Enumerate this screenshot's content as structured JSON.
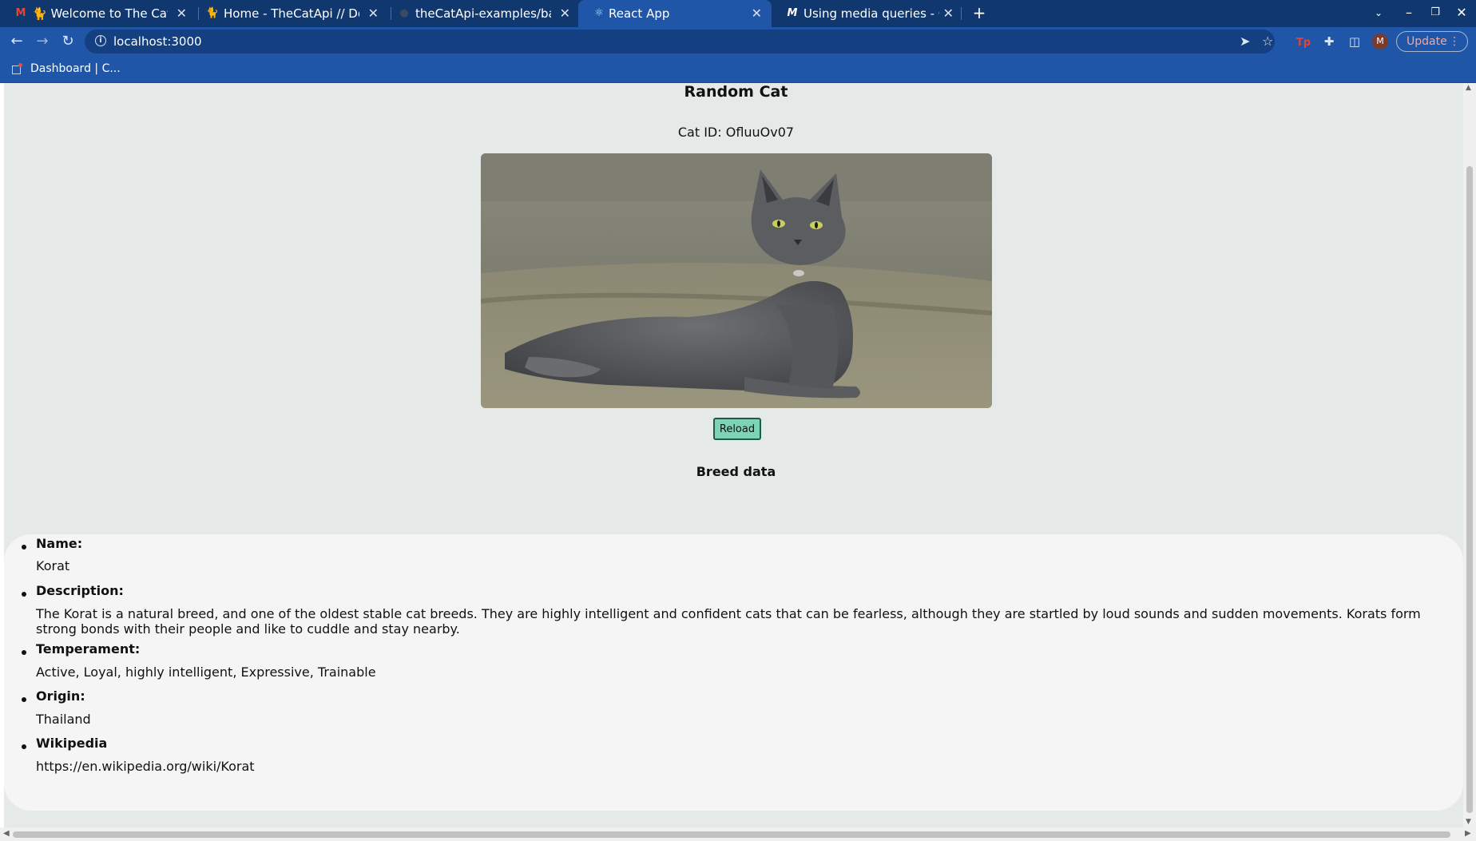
{
  "browser": {
    "tabs": [
      {
        "title": "🐈 Welcome to The Cat API",
        "favicon": "M",
        "favicon_color": "#ea4335"
      },
      {
        "title": "Home - TheCatApi // Developers",
        "favicon": "cat-logo",
        "favicon_color": "#222222"
      },
      {
        "title": "theCatApi-examples/basic",
        "favicon": "github-icon",
        "favicon_color": "#555555"
      },
      {
        "title": "React App",
        "favicon": "react-icon",
        "favicon_color": "#61dafb"
      },
      {
        "title": "Using media queries - CSS",
        "favicon": "M",
        "favicon_color": "#000000"
      }
    ],
    "active_tab_index": 3,
    "url": "localhost:3000",
    "update_label": "Update",
    "profile_initial": "M",
    "bookmark": "Dashboard | C..."
  },
  "page": {
    "title": "Random Cat",
    "cat_id": "Cat ID: OfluuOv07",
    "reload_label": "Reload",
    "breed_heading": "Breed data",
    "breed": [
      {
        "label": "Name:",
        "value": "Korat"
      },
      {
        "label": "Description:",
        "value": "The Korat is a natural breed, and one of the oldest stable cat breeds. They are highly intelligent and confident cats that can be fearless, although they are startled by loud sounds and sudden movements. Korats form strong bonds with their people and like to cuddle and stay nearby."
      },
      {
        "label": "Temperament:",
        "value": "Active, Loyal, highly intelligent, Expressive, Trainable"
      },
      {
        "label": "Origin:",
        "value": "Thailand"
      },
      {
        "label": "Wikipedia",
        "value": "https://en.wikipedia.org/wiki/Korat"
      }
    ]
  },
  "colors": {
    "tab_strip": "#11376f",
    "toolbar": "#1f56a8",
    "page_bg": "#e5e9e8",
    "breed_bg": "#f5f5f5",
    "reload_bg": "#7cd3b6"
  }
}
